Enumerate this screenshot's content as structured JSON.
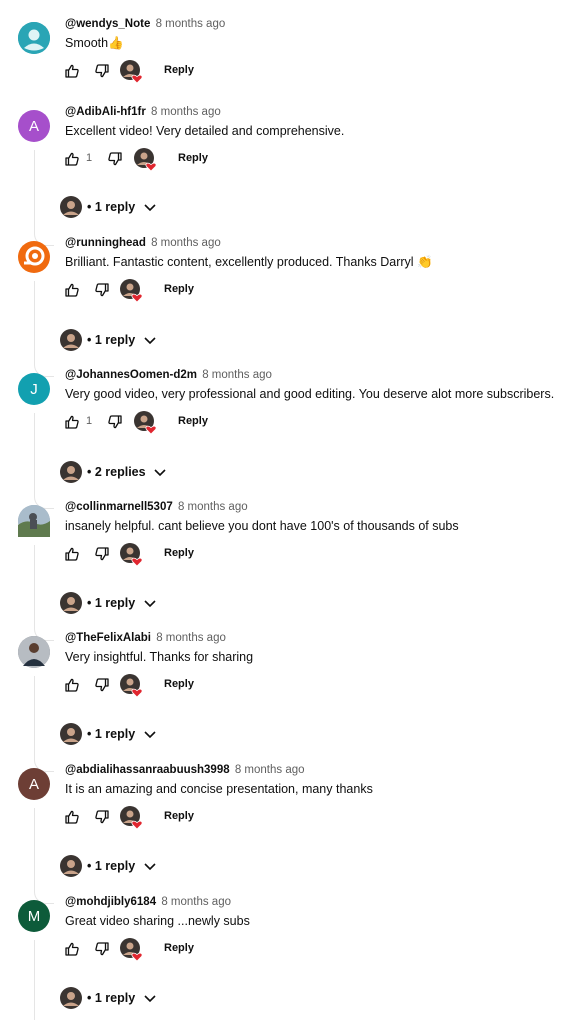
{
  "comments": [
    {
      "author": "@wendys_Note",
      "time": "8 months ago",
      "text": "Smooth",
      "emoji": "👍",
      "likes": "",
      "avatar_letter": "",
      "avatar_color": "#2aa5b5",
      "replies": ""
    },
    {
      "author": "@AdibAli-hf1fr",
      "time": "8 months ago",
      "text": "Excellent video! Very detailed and comprehensive.",
      "emoji": "",
      "likes": "1",
      "avatar_letter": "A",
      "avatar_color": "#a64fcb",
      "replies": "• 1 reply"
    },
    {
      "author": "@runninghead",
      "time": "8 months ago",
      "text": "Brilliant. Fantastic content, excellently produced. Thanks Darryl",
      "emoji": "👏",
      "likes": "",
      "avatar_letter": "",
      "avatar_color": "#f06a0f",
      "replies": "• 1 reply"
    },
    {
      "author": "@JohannesOomen-d2m",
      "time": "8 months ago",
      "text": "Very good video, very professional and good editing. You deserve alot more subscribers.",
      "emoji": "",
      "likes": "1",
      "avatar_letter": "J",
      "avatar_color": "#12a0b0",
      "replies": "• 2 replies"
    },
    {
      "author": "@collinmarnell5307",
      "time": "8 months ago",
      "text": "insanely helpful. cant believe you dont have 100's of thousands of subs",
      "emoji": "",
      "likes": "",
      "avatar_letter": "",
      "avatar_color": "#8fa6b8",
      "replies": "• 1 reply"
    },
    {
      "author": "@TheFelixAlabi",
      "time": "8 months ago",
      "text": "Very insightful. Thanks for sharing",
      "emoji": "",
      "likes": "",
      "avatar_letter": "",
      "avatar_color": "#7a7f86",
      "replies": "• 1 reply"
    },
    {
      "author": "@abdialihassanraabuush3998",
      "time": "8 months ago",
      "text": "It is an amazing and concise presentation, many thanks",
      "emoji": "",
      "likes": "",
      "avatar_letter": "A",
      "avatar_color": "#6d3e35",
      "replies": "• 1 reply"
    },
    {
      "author": "@mohdjibly6184",
      "time": "8 months ago",
      "text": "Great video sharing ...newly subs",
      "emoji": "",
      "likes": "",
      "avatar_letter": "M",
      "avatar_color": "#0d5b3a",
      "replies": "• 1 reply"
    }
  ],
  "reply_label": "Reply",
  "icons": {
    "like": "thumbs-up-icon",
    "dislike": "thumbs-down-icon",
    "creator_heart": "creator-heart-avatar",
    "expand": "chevron-down-icon"
  },
  "colors": {
    "heart": "#e0262f",
    "secondary_text": "#606060"
  }
}
